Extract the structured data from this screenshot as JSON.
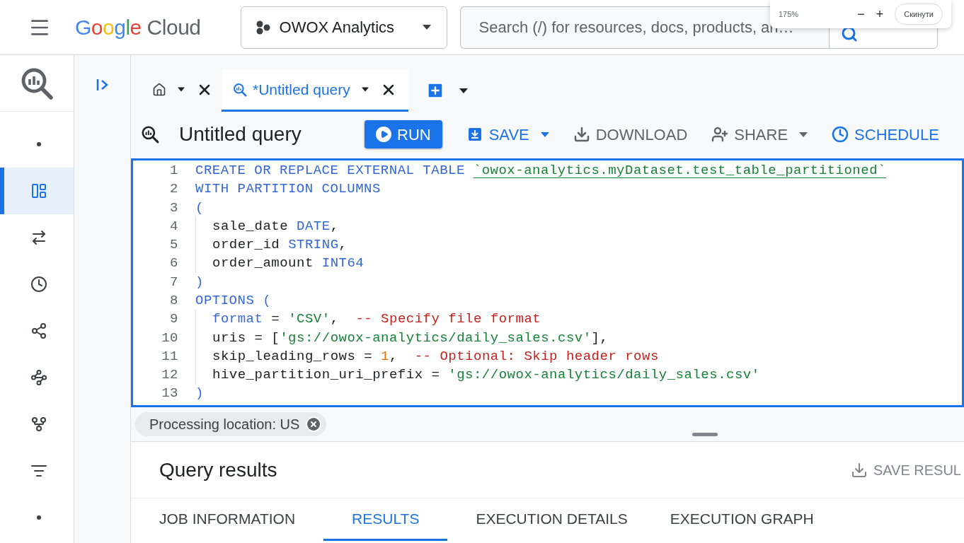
{
  "topbar": {
    "logo": "Google Cloud",
    "project": "OWOX Analytics",
    "search": {
      "placeholder": "Search (/) for resources, docs, products, an…"
    }
  },
  "zoom_popup": {
    "level": "175%",
    "minus": "−",
    "plus": "+",
    "reset": "Скинути"
  },
  "rail": [
    {
      "kind": "dot",
      "selected": false
    },
    {
      "kind": "studio",
      "selected": true
    },
    {
      "kind": "transfer",
      "selected": false
    },
    {
      "kind": "scheduled",
      "selected": false
    },
    {
      "kind": "analytics",
      "selected": false
    },
    {
      "kind": "pipeline",
      "selected": false
    },
    {
      "kind": "graph",
      "selected": false
    },
    {
      "kind": "lines",
      "selected": false
    },
    {
      "kind": "dot",
      "selected": false
    }
  ],
  "tabs": [
    {
      "kind": "home",
      "selected": false
    },
    {
      "kind": "query",
      "label": "*Untitled query",
      "selected": true
    }
  ],
  "query_title": "Untitled query",
  "toolbar": [
    {
      "kind": "run",
      "label": "RUN",
      "menu": false
    },
    {
      "kind": "save",
      "label": "SAVE",
      "menu": true
    },
    {
      "kind": "download",
      "label": "DOWNLOAD",
      "menu": false
    },
    {
      "kind": "share",
      "label": "SHARE",
      "menu": true
    },
    {
      "kind": "schedule",
      "label": "SCHEDULE",
      "menu": false
    }
  ],
  "editor": {
    "lines": [
      {
        "number": "1",
        "indented": false,
        "tokens": [
          {
            "kind": "kw",
            "text": "CREATE OR REPLACE EXTERNAL TABLE "
          },
          {
            "kind": "ref",
            "text": "`owox-analytics.myDataset.test_table_partitioned`"
          }
        ]
      },
      {
        "number": "2",
        "indented": false,
        "tokens": [
          {
            "kind": "kw",
            "text": "WITH PARTITION COLUMNS"
          }
        ]
      },
      {
        "number": "3",
        "indented": false,
        "tokens": [
          {
            "kind": "kw",
            "text": "("
          }
        ]
      },
      {
        "number": "4",
        "indented": true,
        "tokens": [
          {
            "kind": "id",
            "text": "sale_date "
          },
          {
            "kind": "kw",
            "text": "DATE"
          },
          {
            "kind": "id",
            "text": ","
          }
        ]
      },
      {
        "number": "5",
        "indented": true,
        "tokens": [
          {
            "kind": "id",
            "text": "order_id "
          },
          {
            "kind": "kw",
            "text": "STRING"
          },
          {
            "kind": "id",
            "text": ","
          }
        ]
      },
      {
        "number": "6",
        "indented": true,
        "tokens": [
          {
            "kind": "id",
            "text": "order_amount "
          },
          {
            "kind": "kw",
            "text": "INT64"
          }
        ]
      },
      {
        "number": "7",
        "indented": false,
        "tokens": [
          {
            "kind": "kw",
            "text": ")"
          }
        ]
      },
      {
        "number": "8",
        "indented": false,
        "tokens": [
          {
            "kind": "kw",
            "text": "OPTIONS ("
          }
        ]
      },
      {
        "number": "9",
        "indented": true,
        "tokens": [
          {
            "kind": "kw",
            "text": "format"
          },
          {
            "kind": "id",
            "text": " = "
          },
          {
            "kind": "str",
            "text": "'CSV'"
          },
          {
            "kind": "id",
            "text": ",  "
          },
          {
            "kind": "cmt",
            "text": "-- Specify file format"
          }
        ]
      },
      {
        "number": "10",
        "indented": true,
        "tokens": [
          {
            "kind": "id",
            "text": "uris = ["
          },
          {
            "kind": "str",
            "text": "'gs://owox-analytics/daily_sales.csv'"
          },
          {
            "kind": "id",
            "text": "],"
          }
        ]
      },
      {
        "number": "11",
        "indented": true,
        "tokens": [
          {
            "kind": "id",
            "text": "skip_leading_rows = "
          },
          {
            "kind": "num",
            "text": "1"
          },
          {
            "kind": "id",
            "text": ",  "
          },
          {
            "kind": "cmt",
            "text": "-- Optional: Skip header rows"
          }
        ]
      },
      {
        "number": "12",
        "indented": true,
        "tokens": [
          {
            "kind": "id",
            "text": "hive_partition_uri_prefix = "
          },
          {
            "kind": "str",
            "text": "'gs://owox-analytics/daily_sales.csv'"
          }
        ]
      },
      {
        "number": "13",
        "indented": false,
        "tokens": [
          {
            "kind": "kw",
            "text": ")"
          }
        ]
      }
    ]
  },
  "location_chip": "Processing location: US",
  "results": {
    "title": "Query results",
    "save_button": "SAVE RESUL",
    "tabs": [
      {
        "label": "JOB INFORMATION",
        "selected": false
      },
      {
        "label": "RESULTS",
        "selected": true
      },
      {
        "label": "EXECUTION DETAILS",
        "selected": false
      },
      {
        "label": "EXECUTION GRAPH",
        "selected": false
      }
    ]
  }
}
